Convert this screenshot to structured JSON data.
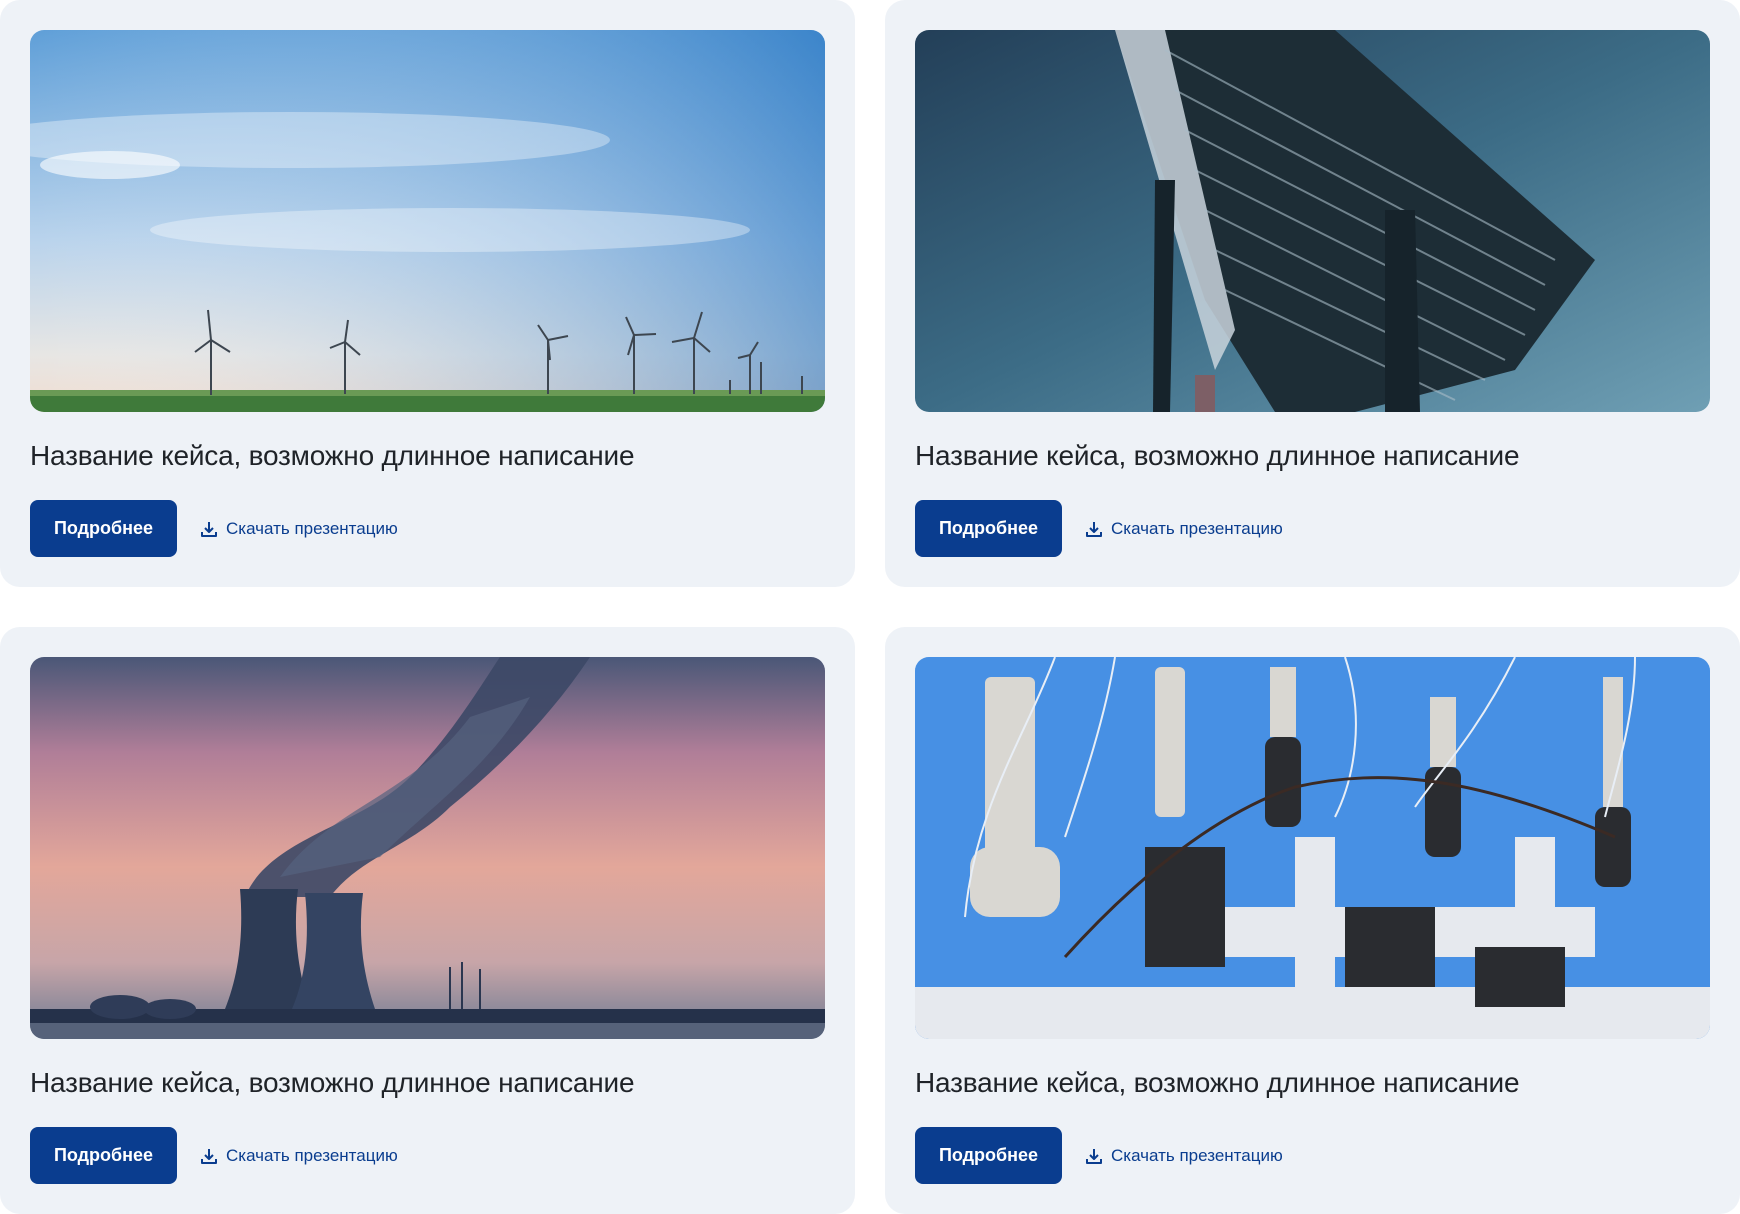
{
  "colors": {
    "card_background": "#eef2f7",
    "primary_button": "#0a3d8f",
    "link": "#0a3d8f",
    "title_text": "#1f2328"
  },
  "cards": [
    {
      "image": "wind-turbines-photo",
      "title": "Название кейса, возможно длинное написание",
      "details_label": "Подробнее",
      "download_label": "Скачать презентацию"
    },
    {
      "image": "solar-panel-photo",
      "title": "Название кейса, возможно длинное написание",
      "details_label": "Подробнее",
      "download_label": "Скачать презентацию"
    },
    {
      "image": "cooling-towers-photo",
      "title": "Название кейса, возможно длинное написание",
      "details_label": "Подробнее",
      "download_label": "Скачать презентацию"
    },
    {
      "image": "electrical-substation-photo",
      "title": "Название кейса, возможно длинное написание",
      "details_label": "Подробнее",
      "download_label": "Скачать презентацию"
    }
  ]
}
